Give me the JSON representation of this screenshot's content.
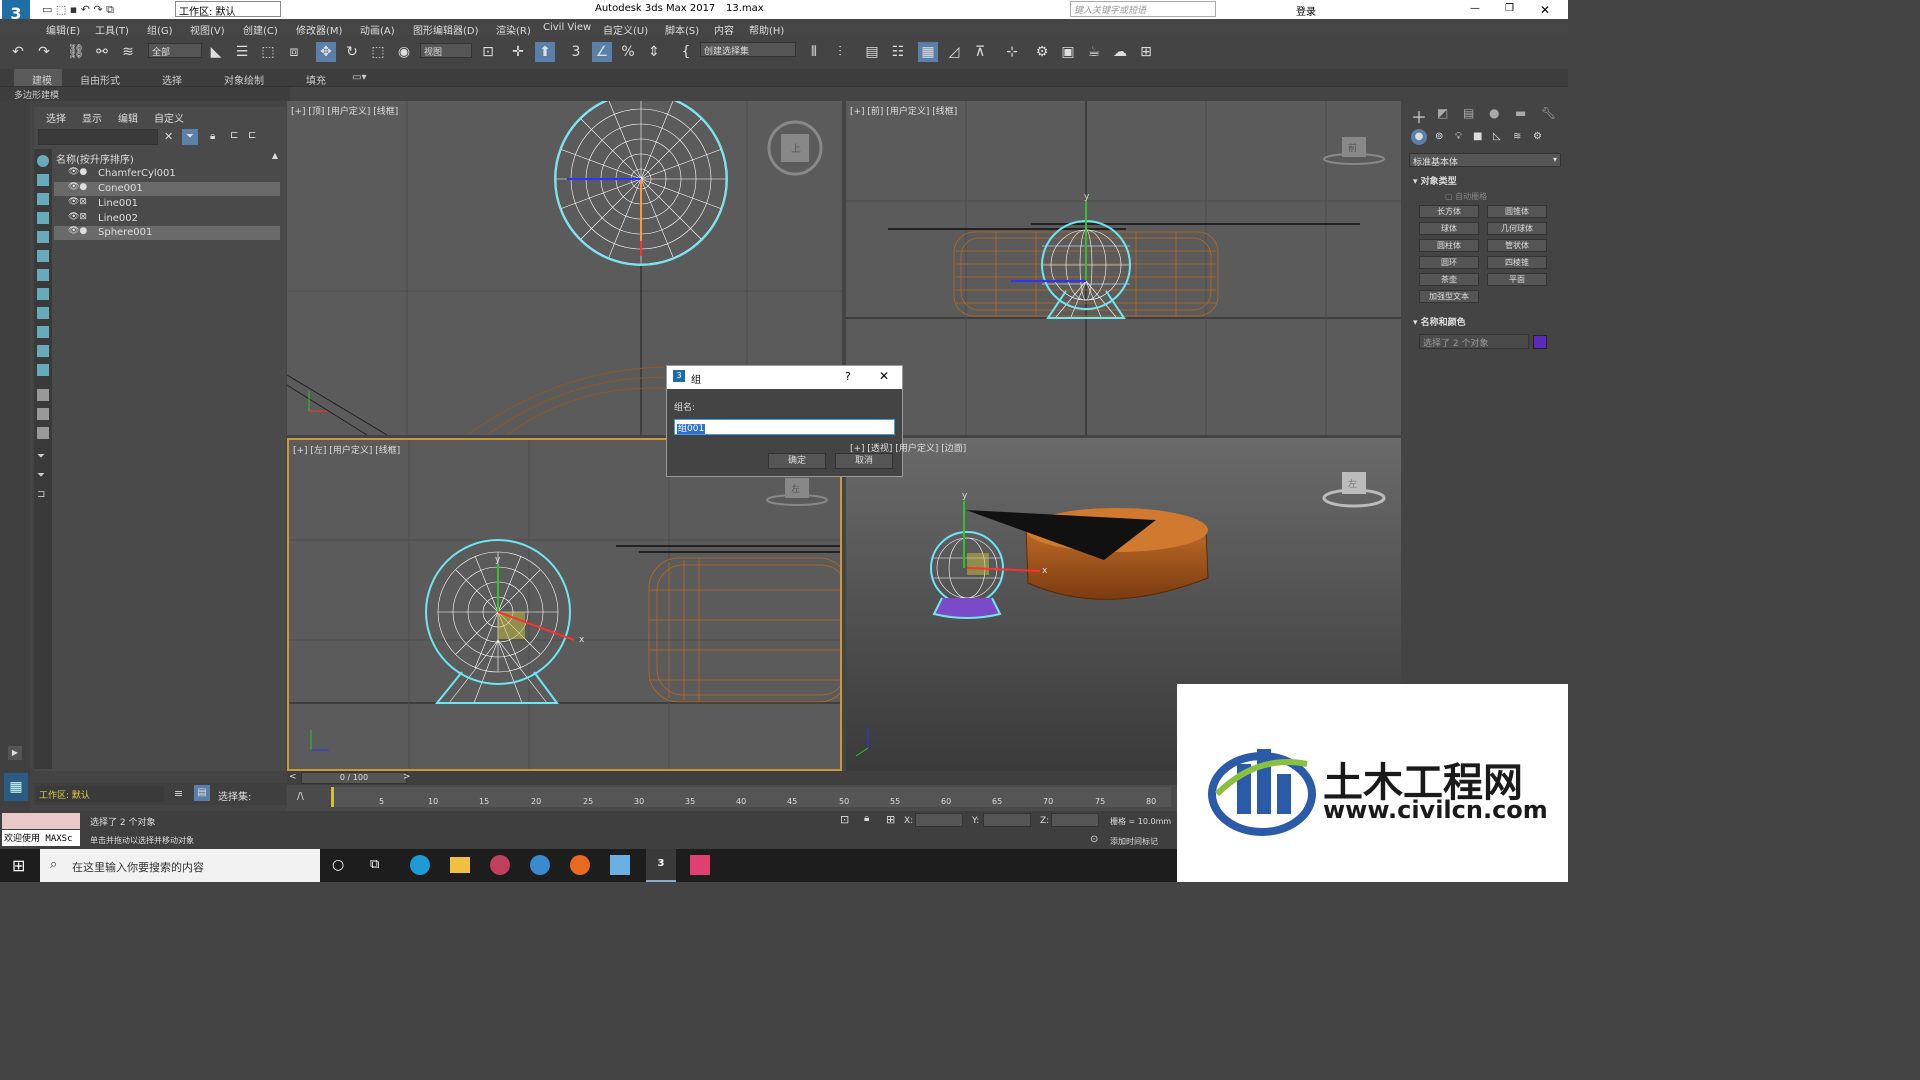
{
  "titlebar": {
    "title": "Autodesk 3ds Max 2017",
    "filename": "13.max",
    "workspace": "工作区: 默认",
    "search_placeholder": "键入关键字或短语",
    "login": "登录"
  },
  "menu": [
    "编辑(E)",
    "工具(T)",
    "组(G)",
    "视图(V)",
    "创建(C)",
    "修改器(M)",
    "动画(A)",
    "图形编辑器(D)",
    "渲染(R)",
    "Civil View",
    "自定义(U)",
    "脚本(S)",
    "内容",
    "帮助(H)"
  ],
  "toolbar": {
    "filter": "全部",
    "view": "视图",
    "selset": "创建选择集"
  },
  "ribbon": {
    "tabs": [
      "建模",
      "自由形式",
      "选择",
      "对象绘制",
      "填充"
    ],
    "sub": "多边形建模"
  },
  "scene_explorer": {
    "tabs": [
      "选择",
      "显示",
      "编辑",
      "自定义"
    ],
    "header": "名称(按升序排序)",
    "items": [
      "ChamferCyl001",
      "Cone001",
      "Line001",
      "Line002",
      "Sphere001"
    ]
  },
  "viewports": {
    "top": "[+] [顶] [用户定义] [线框]",
    "front": "[+] [前] [用户定义] [线框]",
    "left": "[+] [左] [用户定义] [线框]",
    "persp": "[+] [透视] [用户定义] [边面]",
    "cube_top": "上",
    "cube_front": "前",
    "cube_left": "左",
    "cube_persp": "左"
  },
  "cmd_panel": {
    "category": "标准基本体",
    "section_object": "对象类型",
    "autogrid": "自动栅格",
    "buttons": [
      "长方体",
      "圆锥体",
      "球体",
      "几何球体",
      "圆柱体",
      "管状体",
      "圆环",
      "四棱锥",
      "茶壶",
      "平面",
      "加强型文本"
    ],
    "section_name": "名称和颜色",
    "name_value": "选择了 2 个对象",
    "color": "#5a2ab8"
  },
  "dialog": {
    "title": "组",
    "label": "组名:",
    "value": "组001",
    "ok": "确定",
    "cancel": "取消",
    "help": "?"
  },
  "timeline": {
    "frame": "0 / 100",
    "ticks": [
      "5",
      "10",
      "15",
      "20",
      "25",
      "30",
      "35",
      "40",
      "45",
      "50",
      "55",
      "60",
      "65",
      "70",
      "75",
      "80"
    ]
  },
  "status": {
    "workspace": "工作区: 默认",
    "selset": "选择集:",
    "msg1": "选择了 2 个对象",
    "msg2": "单击并拖动以选择并移动对象",
    "maxscript": "欢迎使用 MAXSc",
    "x": "X:",
    "y": "Y:",
    "z": "Z:",
    "grid": "栅格 = 10.0mm",
    "addtime": "添加时间标记"
  },
  "taskbar": {
    "search": "在这里输入你要搜索的内容"
  },
  "watermark": {
    "name": "土木工程网",
    "url": "www.civilcn.com"
  }
}
